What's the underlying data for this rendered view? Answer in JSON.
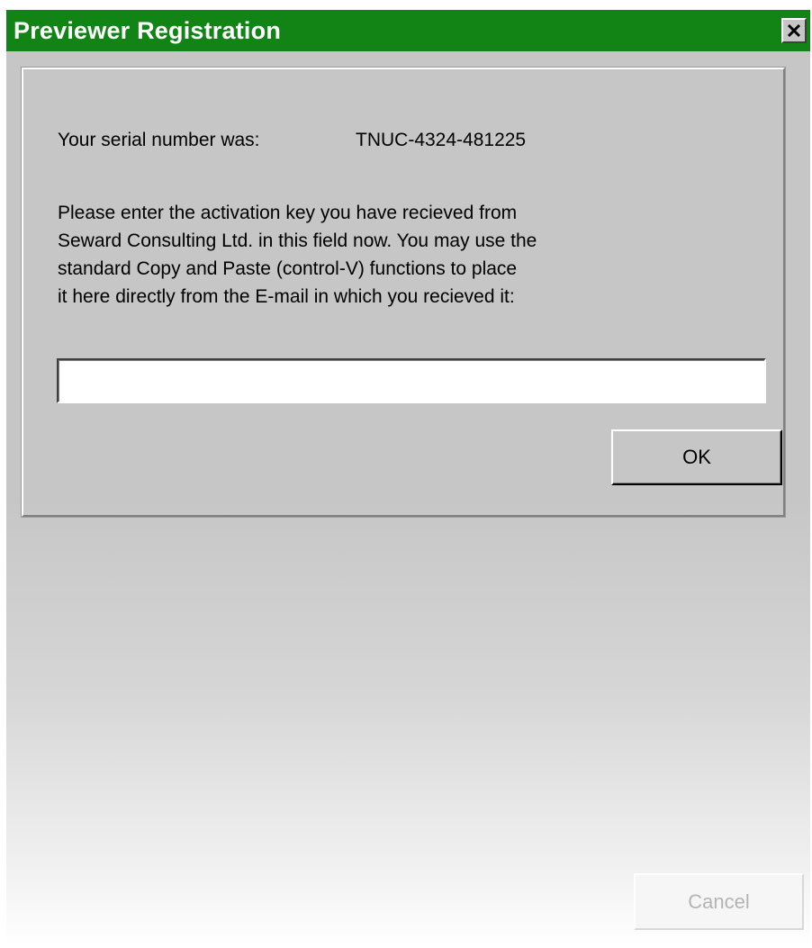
{
  "window": {
    "title": "Previewer Registration",
    "title_bar_color": "#128416",
    "close_icon": "close-icon"
  },
  "serial": {
    "label": "Your serial number was:",
    "value": "TNUC-4324-481225"
  },
  "instructions": {
    "lines": [
      "Please enter the activation key you have recieved from",
      "Seward Consulting Ltd. in this field now. You may use the",
      "standard Copy and Paste (control-V) functions to place",
      "it here directly from the E-mail in which you recieved it:"
    ]
  },
  "activation_key": {
    "value": "",
    "placeholder": ""
  },
  "buttons": {
    "ok_label": "OK",
    "cancel_label": "Cancel",
    "cancel_enabled": false
  }
}
